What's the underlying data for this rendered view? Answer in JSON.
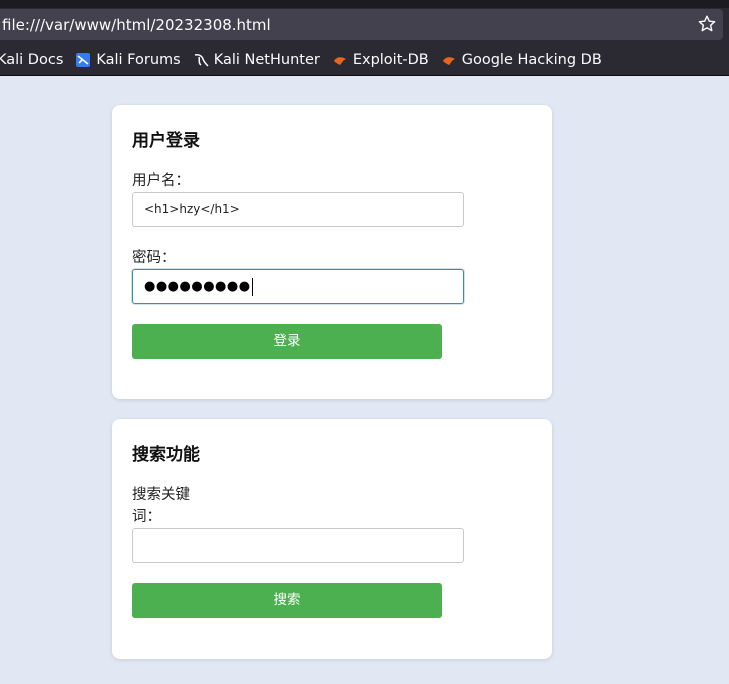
{
  "browser": {
    "url": "file:///var/www/html/20232308.html",
    "bookmarks": [
      {
        "label": "Kali Docs",
        "icon": "kali-docs-icon"
      },
      {
        "label": "Kali Forums",
        "icon": "kali-forums-icon"
      },
      {
        "label": "Kali NetHunter",
        "icon": "kali-nethunter-icon"
      },
      {
        "label": "Exploit-DB",
        "icon": "exploit-db-icon"
      },
      {
        "label": "Google Hacking DB",
        "icon": "ghdb-icon"
      }
    ]
  },
  "login": {
    "title": "用户登录",
    "username_label": "用户名：",
    "username_value": "<h1>hzy</h1>",
    "password_label": "密码：",
    "password_value": "●●●●●●●●●",
    "submit_label": "登录"
  },
  "search": {
    "title": "搜索功能",
    "keyword_label_line1": "搜索关键",
    "keyword_label_line2": "词：",
    "keyword_value": "",
    "submit_label": "搜索"
  },
  "colors": {
    "accent_button": "#4caf50",
    "page_background": "#e2e8f3",
    "focus_border": "#3a8bb8"
  }
}
